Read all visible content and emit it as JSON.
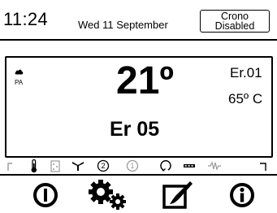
{
  "header": {
    "time": "11:24",
    "date": "Wed 11 September",
    "crono_line1": "Crono",
    "crono_line2": "Disabled"
  },
  "display": {
    "mode_icon": "cloud-icon",
    "mode_label": "PA",
    "temperature": "21º",
    "error_code": "Er.01",
    "secondary_temp": "65º C",
    "error_display": "Er 05"
  },
  "status_icons": [
    "left-arrow-icon",
    "thermometer-icon",
    "tank-icon",
    "fan-icon",
    "stage-2-icon",
    "stage-1-icon",
    "circulation-icon",
    "key-icon",
    "heater-icon",
    "right-arrow-icon"
  ],
  "stage_numbers": {
    "stage2": "2",
    "stage1": "1"
  },
  "buttons": [
    "power-icon",
    "gears-icon",
    "edit-icon",
    "info-icon"
  ],
  "colors": {
    "text": "#000000",
    "inactive": "#9a9a9a",
    "background": "#ffffff"
  }
}
